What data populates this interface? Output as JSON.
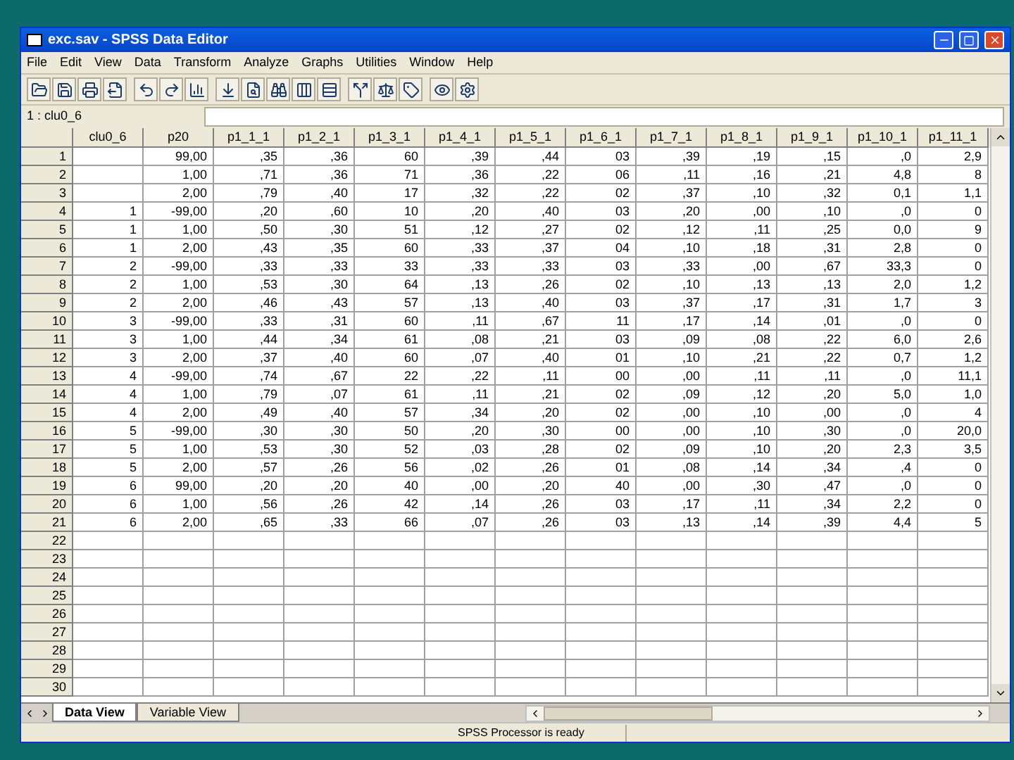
{
  "window": {
    "title": "exc.sav - SPSS Data Editor"
  },
  "menu": [
    "File",
    "Edit",
    "View",
    "Data",
    "Transform",
    "Analyze",
    "Graphs",
    "Utilities",
    "Window",
    "Help"
  ],
  "cell_editor": {
    "reference": "1 : clu0_6"
  },
  "table": {
    "columns": [
      "clu0_6",
      "p20",
      "p1_1_1",
      "p1_2_1",
      "p1_3_1",
      "p1_4_1",
      "p1_5_1",
      "p1_6_1",
      "p1_7_1",
      "p1_8_1",
      "p1_9_1",
      "p1_10_1",
      "p1_11_1"
    ],
    "rows": [
      {
        "number": "1",
        "cells": [
          null,
          "99,00",
          ",35",
          ",36",
          "60",
          ",39",
          ",44",
          "03",
          ",39",
          ",19",
          ",15",
          ",0",
          "2,9"
        ]
      },
      {
        "number": "2",
        "cells": [
          null,
          "1,00",
          ",71",
          ",36",
          "71",
          ",36",
          ",22",
          "06",
          ",11",
          ",16",
          ",21",
          "4,8",
          "8"
        ]
      },
      {
        "number": "3",
        "cells": [
          null,
          "2,00",
          ",79",
          ",40",
          "17",
          ",32",
          ",22",
          "02",
          ",37",
          ",10",
          ",32",
          "0,1",
          "1,1"
        ]
      },
      {
        "number": "4",
        "cells": [
          "1",
          "-99,00",
          ",20",
          ",60",
          "10",
          ",20",
          ",40",
          "03",
          ",20",
          ",00",
          ",10",
          ",0",
          "0"
        ]
      },
      {
        "number": "5",
        "cells": [
          "1",
          "1,00",
          ",50",
          ",30",
          "51",
          ",12",
          ",27",
          "02",
          ",12",
          ",11",
          ",25",
          "0,0",
          "9"
        ]
      },
      {
        "number": "6",
        "cells": [
          "1",
          "2,00",
          ",43",
          ",35",
          "60",
          ",33",
          ",37",
          "04",
          ",10",
          ",18",
          ",31",
          "2,8",
          "0"
        ]
      },
      {
        "number": "7",
        "cells": [
          "2",
          "-99,00",
          ",33",
          ",33",
          "33",
          ",33",
          ",33",
          "03",
          ",33",
          ",00",
          ",67",
          "33,3",
          "0"
        ]
      },
      {
        "number": "8",
        "cells": [
          "2",
          "1,00",
          ",53",
          ",30",
          "64",
          ",13",
          ",26",
          "02",
          ",10",
          ",13",
          ",13",
          "2,0",
          "1,2"
        ]
      },
      {
        "number": "9",
        "cells": [
          "2",
          "2,00",
          ",46",
          ",43",
          "57",
          ",13",
          ",40",
          "03",
          ",37",
          ",17",
          ",31",
          "1,7",
          "3"
        ]
      },
      {
        "number": "10",
        "cells": [
          "3",
          "-99,00",
          ",33",
          ",31",
          "60",
          ",11",
          ",67",
          "11",
          ",17",
          ",14",
          ",01",
          ",0",
          "0"
        ]
      },
      {
        "number": "11",
        "cells": [
          "3",
          "1,00",
          ",44",
          ",34",
          "61",
          ",08",
          ",21",
          "03",
          ",09",
          ",08",
          ",22",
          "6,0",
          "2,6"
        ]
      },
      {
        "number": "12",
        "cells": [
          "3",
          "2,00",
          ",37",
          ",40",
          "60",
          ",07",
          ",40",
          "01",
          ",10",
          ",21",
          ",22",
          "0,7",
          "1,2"
        ]
      },
      {
        "number": "13",
        "cells": [
          "4",
          "-99,00",
          ",74",
          ",67",
          "22",
          ",22",
          ",11",
          "00",
          ",00",
          ",11",
          ",11",
          ",0",
          "11,1"
        ]
      },
      {
        "number": "14",
        "cells": [
          "4",
          "1,00",
          ",79",
          ",07",
          "61",
          ",11",
          ",21",
          "02",
          ",09",
          ",12",
          ",20",
          "5,0",
          "1,0"
        ]
      },
      {
        "number": "15",
        "cells": [
          "4",
          "2,00",
          ",49",
          ",40",
          "57",
          ",34",
          ",20",
          "02",
          ",00",
          ",10",
          ",00",
          ",0",
          "4"
        ]
      },
      {
        "number": "16",
        "cells": [
          "5",
          "-99,00",
          ",30",
          ",30",
          "50",
          ",20",
          ",30",
          "00",
          ",00",
          ",10",
          ",30",
          ",0",
          "20,0"
        ]
      },
      {
        "number": "17",
        "cells": [
          "5",
          "1,00",
          ",53",
          ",30",
          "52",
          ",03",
          ",28",
          "02",
          ",09",
          ",10",
          ",20",
          "2,3",
          "3,5"
        ]
      },
      {
        "number": "18",
        "cells": [
          "5",
          "2,00",
          ",57",
          ",26",
          "56",
          ",02",
          ",26",
          "01",
          ",08",
          ",14",
          ",34",
          ",4",
          "0"
        ]
      },
      {
        "number": "19",
        "cells": [
          "6",
          "99,00",
          ",20",
          ",20",
          "40",
          ",00",
          ",20",
          "40",
          ",00",
          ",30",
          ",47",
          ",0",
          "0"
        ]
      },
      {
        "number": "20",
        "cells": [
          "6",
          "1,00",
          ",56",
          ",26",
          "42",
          ",14",
          ",26",
          "03",
          ",17",
          ",11",
          ",34",
          "2,2",
          "0"
        ]
      },
      {
        "number": "21",
        "cells": [
          "6",
          "2,00",
          ",65",
          ",33",
          "66",
          ",07",
          ",26",
          "03",
          ",13",
          ",14",
          ",39",
          "4,4",
          "5"
        ]
      },
      {
        "number": "22"
      },
      {
        "number": "23"
      },
      {
        "number": "24"
      },
      {
        "number": "25"
      },
      {
        "number": "26"
      },
      {
        "number": "27"
      },
      {
        "number": "28"
      },
      {
        "number": "29"
      },
      {
        "number": "30"
      }
    ]
  },
  "tabs": [
    {
      "label": "Data View",
      "selected": true
    },
    {
      "label": "Variable View",
      "selected": false
    }
  ],
  "status_bar": {
    "message": "SPSS Processor is ready"
  }
}
